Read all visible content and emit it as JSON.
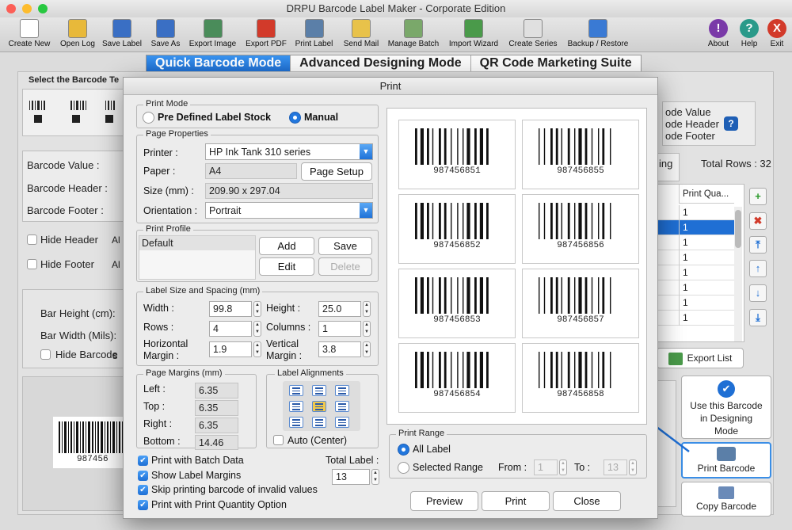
{
  "app": {
    "title": "DRPU Barcode Label Maker - Corporate Edition"
  },
  "toolbar": [
    {
      "label": "Create New",
      "icon": "new-document-icon",
      "color": "#ffffff"
    },
    {
      "label": "Open Log",
      "icon": "open-folder-icon",
      "color": "#e8b93a"
    },
    {
      "label": "Save Label",
      "icon": "save-icon",
      "color": "#3a6fc4"
    },
    {
      "label": "Save As",
      "icon": "save-as-icon",
      "color": "#3a6fc4"
    },
    {
      "label": "Export Image",
      "icon": "export-image-icon",
      "color": "#4a8c5a"
    },
    {
      "label": "Export PDF",
      "icon": "pdf-icon",
      "color": "#d23a2a"
    },
    {
      "label": "Print Label",
      "icon": "printer-icon",
      "color": "#5b7fa8"
    },
    {
      "label": "Send Mail",
      "icon": "mail-icon",
      "color": "#e8c24a"
    },
    {
      "label": "Manage Batch",
      "icon": "batch-icon",
      "color": "#7aa86a"
    },
    {
      "label": "Import Wizard",
      "icon": "import-wizard-icon",
      "color": "#4a9a4a"
    },
    {
      "label": "Create Series",
      "icon": "sigma-icon",
      "color": "#e0e0e0"
    },
    {
      "label": "Backup / Restore",
      "icon": "backup-restore-icon",
      "color": "#3a7ad4"
    }
  ],
  "toolbar_right": [
    {
      "label": "About",
      "icon": "about-icon",
      "glyph": "!",
      "color": "#7a3aa8"
    },
    {
      "label": "Help",
      "icon": "help-icon",
      "glyph": "?",
      "color": "#2a9a8a"
    },
    {
      "label": "Exit",
      "icon": "exit-icon",
      "glyph": "X",
      "color": "#d23a2a"
    }
  ],
  "modes": [
    "Quick Barcode Mode",
    "Advanced Designing Mode",
    "QR Code Marketing Suite"
  ],
  "background": {
    "select_barcode": "Select the Barcode Te",
    "barcode_value": "Barcode Value :",
    "barcode_header": "Barcode Header :",
    "barcode_footer": "Barcode Footer :",
    "hide_header": "Hide Header",
    "hide_footer": "Hide Footer",
    "bar_height": "Bar Height (cm):",
    "bar_width": "Bar Width (Mils):",
    "hide_barcode": "Hide Barcode",
    "opt_value": "ode Value",
    "opt_header": "ode Header",
    "opt_footer": "ode Footer",
    "tab_partial": "ing",
    "total_rows": "Total Rows : 32",
    "col_print_qty": "Print Qua...",
    "qty_rows": [
      "1",
      "1",
      "1",
      "1",
      "1",
      "1",
      "1",
      "1"
    ],
    "export_list": "Export List",
    "use_designing": "Use this Barcode in Designing Mode",
    "print_barcode": "Print Barcode",
    "copy_barcode": "Copy Barcode",
    "canvas_number": "987456",
    "frag_al": "Al",
    "frag_s": "s"
  },
  "dialog": {
    "title": "Print",
    "print_mode": {
      "label": "Print Mode",
      "opt1": "Pre Defined Label Stock",
      "opt2": "Manual"
    },
    "page_props": {
      "label": "Page Properties",
      "printer_lbl": "Printer :",
      "printer_val": "HP Ink Tank 310 series",
      "paper_lbl": "Paper :",
      "paper_val": "A4",
      "page_setup": "Page Setup",
      "size_lbl": "Size (mm) :",
      "size_val": "209.90 x 297.04",
      "orient_lbl": "Orientation :",
      "orient_val": "Portrait"
    },
    "profile": {
      "label": "Print Profile",
      "item": "Default",
      "add": "Add",
      "save": "Save",
      "edit": "Edit",
      "delete": "Delete"
    },
    "spacing": {
      "label": "Label Size and Spacing (mm)",
      "width_lbl": "Width :",
      "width_val": "99.8",
      "height_lbl": "Height :",
      "height_val": "25.0",
      "rows_lbl": "Rows :",
      "rows_val": "4",
      "cols_lbl": "Columns :",
      "cols_val": "1",
      "hmargin_lbl1": "Horizontal",
      "hmargin_lbl2": "Margin :",
      "hmargin_val": "1.9",
      "vmargin_lbl1": "Vertical",
      "vmargin_lbl2": "Margin :",
      "vmargin_val": "3.8"
    },
    "margins": {
      "label": "Page Margins (mm)",
      "left_lbl": "Left :",
      "left_val": "6.35",
      "top_lbl": "Top :",
      "top_val": "6.35",
      "right_lbl": "Right :",
      "right_val": "6.35",
      "bottom_lbl": "Bottom :",
      "bottom_val": "14.46"
    },
    "align": {
      "label": "Label Alignments",
      "auto": "Auto (Center)"
    },
    "checks": [
      "Print with Batch Data",
      "Show Label Margins",
      "Skip printing barcode of invalid values",
      "Print with Print Quantity Option"
    ],
    "total_label": {
      "label": "Total Label :",
      "value": "13"
    },
    "labels": [
      "987456851",
      "987456855",
      "987456852",
      "987456856",
      "987456853",
      "987456857",
      "987456854",
      "987456858"
    ],
    "range": {
      "label": "Print Range",
      "all": "All Label",
      "selected": "Selected Range",
      "from_lbl": "From :",
      "from_val": "1",
      "to_lbl": "To :",
      "to_val": "13"
    },
    "buttons": {
      "preview": "Preview",
      "print": "Print",
      "close": "Close"
    }
  }
}
